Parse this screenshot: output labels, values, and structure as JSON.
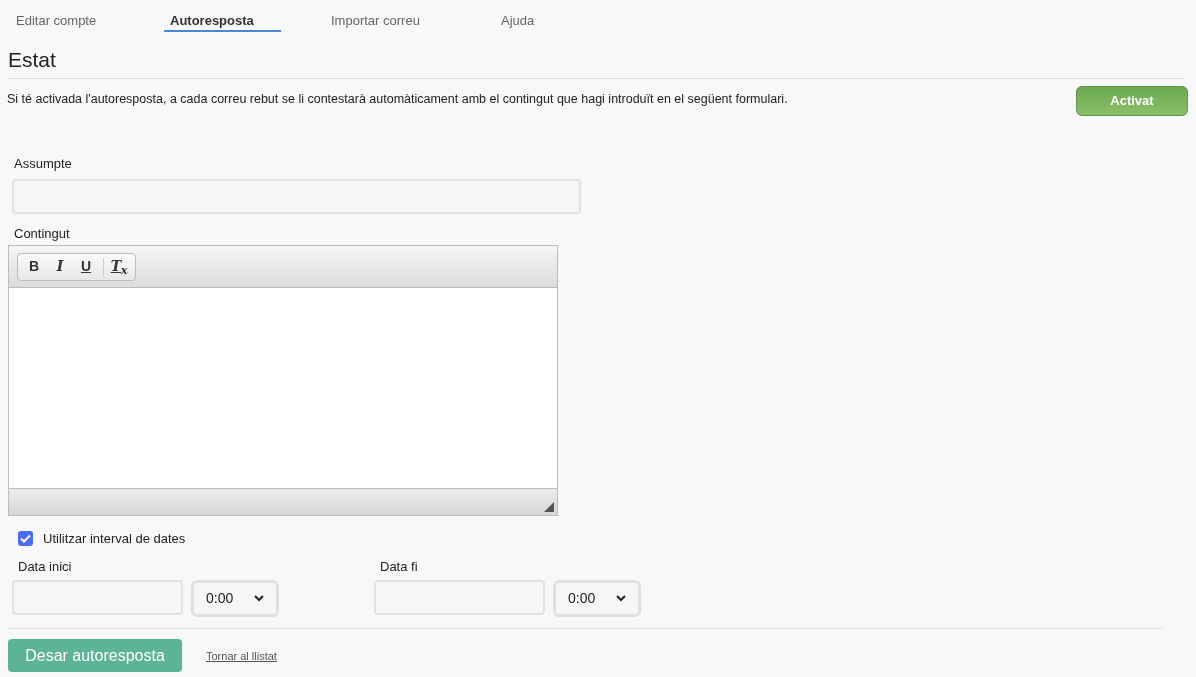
{
  "tabs": [
    {
      "label": "Editar compte",
      "selected": false
    },
    {
      "label": "Autoresposta",
      "selected": true
    },
    {
      "label": "Importar correu",
      "selected": false
    },
    {
      "label": "Ajuda",
      "selected": false
    }
  ],
  "section_title": "Estat",
  "description": "Si té activada l'autoresposta, a cada correu rebut se li contestarà automàticament amb el contingut que hagi introduït en el següent formulari.",
  "status_button": {
    "label": "Activat",
    "on": true
  },
  "subject": {
    "label": "Assumpte"
  },
  "content": {
    "label": "Contingut",
    "toolbar": [
      {
        "kind": "bold",
        "label": "B"
      },
      {
        "kind": "italic",
        "label": "I"
      },
      {
        "kind": "underline",
        "label": "U"
      },
      {
        "kind": "clear",
        "label": "T$_{x}$"
      }
    ]
  },
  "date_range": {
    "label": "Utilitzar interval de dates",
    "checked": true
  },
  "start": {
    "label": "Data inici",
    "time": "0:00"
  },
  "end": {
    "label": "Data fi",
    "time": "0:00"
  },
  "save_button": "Desar autoresposta",
  "back_link": "Tornar al llistat"
}
